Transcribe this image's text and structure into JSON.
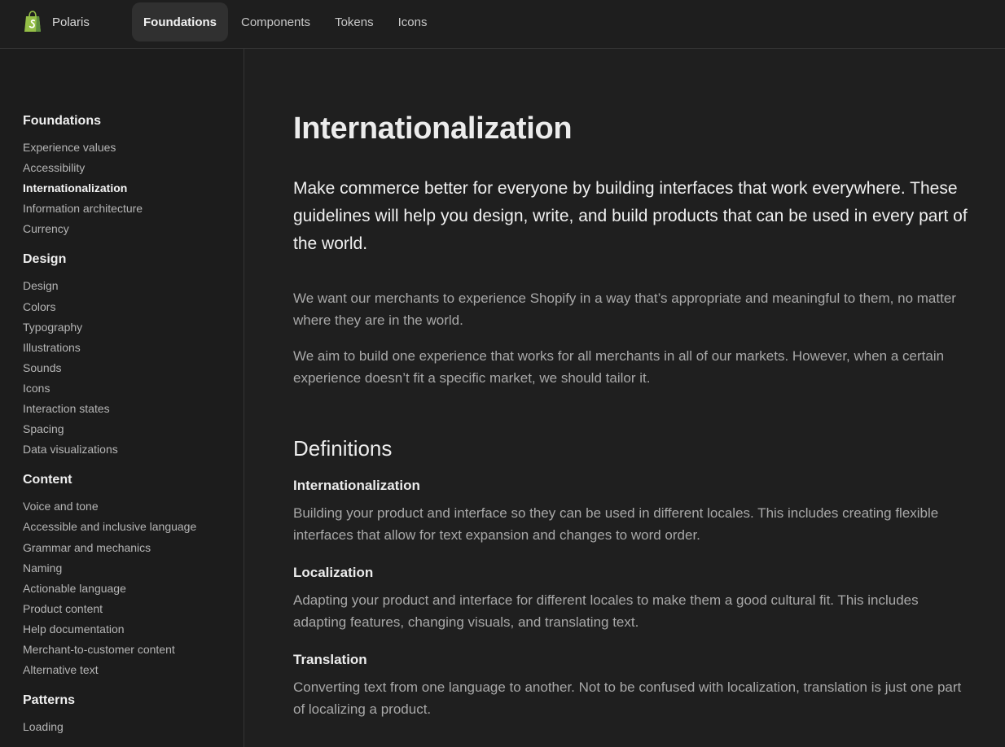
{
  "header": {
    "brand_name": "Polaris",
    "logo_icon": "shopify-bag-icon",
    "brand_color": "#95bf47",
    "nav": [
      {
        "label": "Foundations",
        "active": true
      },
      {
        "label": "Components",
        "active": false
      },
      {
        "label": "Tokens",
        "active": false
      },
      {
        "label": "Icons",
        "active": false
      }
    ]
  },
  "sidebar": {
    "sections": [
      {
        "title": "Foundations",
        "items": [
          "Experience values",
          "Accessibility",
          "Internationalization",
          "Information architecture",
          "Currency"
        ],
        "active_item": "Internationalization"
      },
      {
        "title": "Design",
        "items": [
          "Design",
          "Colors",
          "Typography",
          "Illustrations",
          "Sounds",
          "Icons",
          "Interaction states",
          "Spacing",
          "Data visualizations"
        ]
      },
      {
        "title": "Content",
        "items": [
          "Voice and tone",
          "Accessible and inclusive language",
          "Grammar and mechanics",
          "Naming",
          "Actionable language",
          "Product content",
          "Help documentation",
          "Merchant-to-customer content",
          "Alternative text"
        ]
      },
      {
        "title": "Patterns",
        "items": [
          "Loading"
        ]
      }
    ]
  },
  "main": {
    "title": "Internationalization",
    "lead": "Make commerce better for everyone by building interfaces that work everywhere. These guidelines will help you design, write, and build products that can be used in every part of the world.",
    "paragraphs": [
      "We want our merchants to experience Shopify in a way that’s appropriate and meaningful to them, no matter where they are in the world.",
      "We aim to build one experience that works for all merchants in all of our markets. However, when a certain experience doesn’t fit a specific market, we should tailor it."
    ],
    "definitions_heading": "Definitions",
    "definitions": [
      {
        "term": "Internationalization",
        "description": "Building your product and interface so they can be used in different locales. This includes creating flexible interfaces that allow for text expansion and changes to word order."
      },
      {
        "term": "Localization",
        "description": "Adapting your product and interface for different locales to make them a good cultural fit. This includes adapting features, changing visuals, and translating text."
      },
      {
        "term": "Translation",
        "description": "Converting text from one language to another. Not to be confused with localization, translation is just one part of localizing a product."
      }
    ]
  }
}
